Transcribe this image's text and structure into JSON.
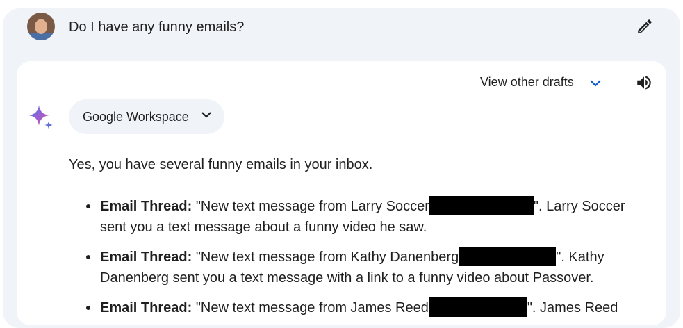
{
  "prompt": {
    "text": "Do I have any funny emails?"
  },
  "toolbar": {
    "drafts_label": "View other drafts"
  },
  "extension_chip": {
    "label": "Google Workspace"
  },
  "response": {
    "intro": "Yes, you have several funny emails in your inbox.",
    "threads": [
      {
        "label": "Email Thread:",
        "quote_start": " \"New text message from Larry Soccer",
        "quote_end": "\". Larry Soccer sent you a text message about a funny video he saw."
      },
      {
        "label": "Email Thread:",
        "quote_start": " \"New text message from Kathy Danenberg",
        "quote_end": "\". Kathy Danenberg sent you a text message with a link to a funny video about Passover."
      },
      {
        "label": "Email Thread:",
        "quote_start": " \"New text message from James Reed",
        "quote_end": "\". James Reed"
      }
    ]
  },
  "colors": {
    "background": "#f0f4f9",
    "card": "#ffffff",
    "text": "#1f1f1f",
    "accent": "#0b57d0"
  }
}
